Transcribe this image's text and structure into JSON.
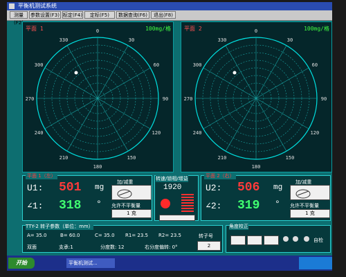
{
  "window": {
    "title": "平衡机测试系统"
  },
  "menu": [
    "测量(F2)",
    "参数设置(F3)",
    "标定(F4)",
    "定标(F5)",
    "数据查询(F6)",
    "退出(F8)"
  ],
  "plane1": {
    "title": "平面 1",
    "scale": "100mg/格"
  },
  "plane2": {
    "title": "平面 2",
    "scale": "100mg/格"
  },
  "polar_labels": [
    "0",
    "30",
    "60",
    "90",
    "120",
    "150",
    "180",
    "210",
    "240",
    "270",
    "300",
    "330"
  ],
  "left_panel": {
    "title": "平面 1（左）",
    "u_label": "U1:",
    "u_value": "501",
    "u_unit": "mg",
    "a_label": "∠1:",
    "a_value": "318",
    "a_unit": "°",
    "add_sub": "加/减重",
    "allow": "允许不平衡量",
    "allow_value": "1 克"
  },
  "right_panel": {
    "title": "平面 2（右）",
    "u_label": "U2:",
    "u_value": "506",
    "u_unit": "mg",
    "a_label": "∠2:",
    "a_value": "319",
    "a_unit": "°",
    "add_sub": "加/减重",
    "allow": "允许不平衡量",
    "allow_value": "1 克"
  },
  "center_panel": {
    "title": "转速/锁相/增益",
    "speed": "1920"
  },
  "params": {
    "title": "TTY-2 转子参数（单位：mm）",
    "row1": [
      "A= 35.0",
      "B= 60.0",
      "C= 35.0",
      "R1= 23.5",
      "R2= 23.5"
    ],
    "rotor_no": "转子号",
    "rotor_value": "2",
    "row2": [
      "双面",
      "支承:1",
      "分度数: 12",
      "右分度偏转: 0°"
    ]
  },
  "angle": {
    "title": "角度校正",
    "auto": "自检"
  },
  "taskbar": {
    "start": "开始",
    "item": "平衡机测试..."
  },
  "colors": {
    "accent": "#00e0e0",
    "value": "#ff3a3a",
    "angle": "#40ff70",
    "bg": "#0d6e70"
  }
}
